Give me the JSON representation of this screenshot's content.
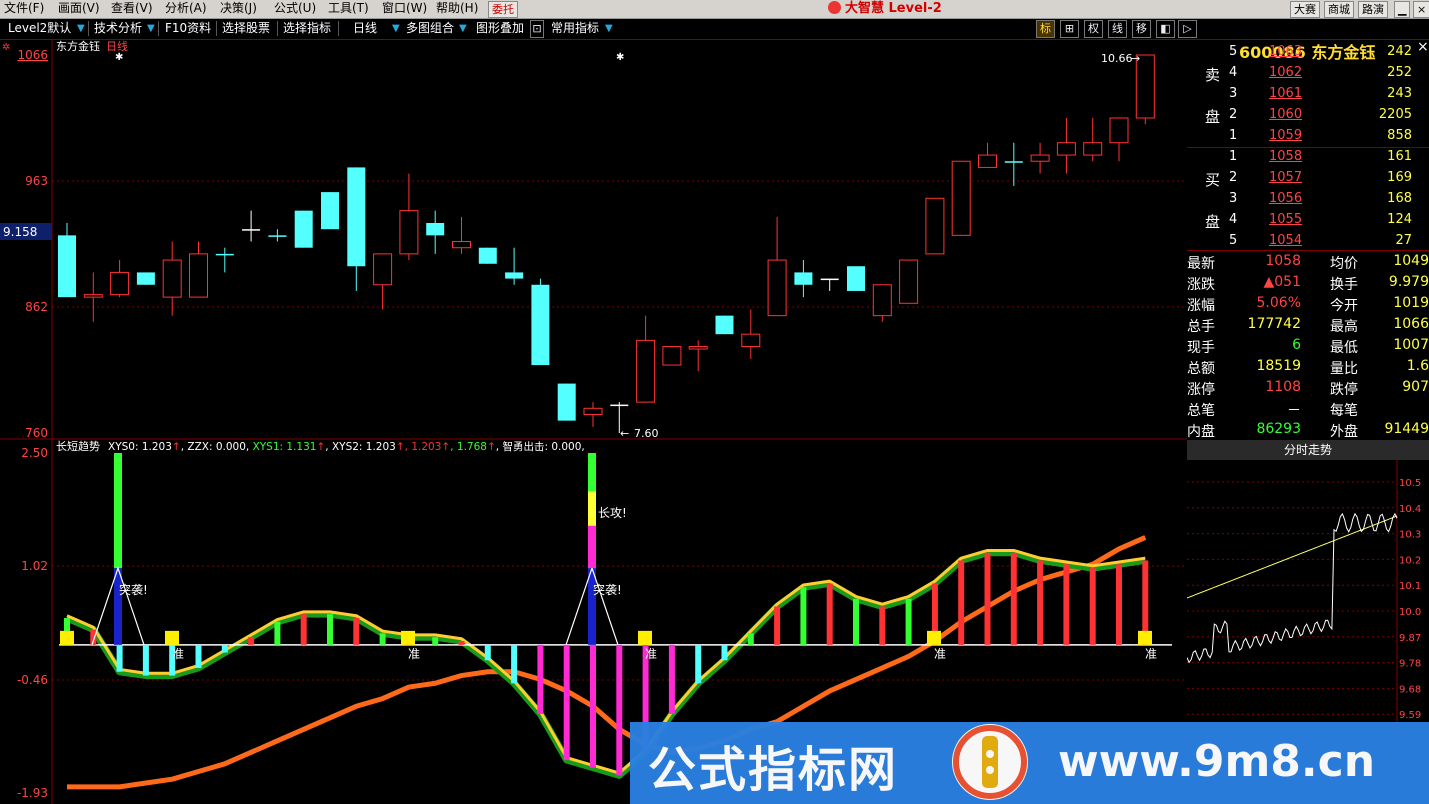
{
  "menubar": {
    "items": [
      "文件(F)",
      "画面(V)",
      "查看(V)",
      "分析(A)",
      "决策(J)",
      "公式(U)",
      "工具(T)",
      "窗口(W)",
      "帮助(H)"
    ],
    "entrust": "委托",
    "title": "大智慧 Level-2",
    "right_buttons": [
      "大赛",
      "商城",
      "路演"
    ]
  },
  "toolbar": {
    "items": [
      "Level2默认",
      "技术分析",
      "F10资料",
      "选择股票",
      "选择指标",
      "日线",
      "多图组合",
      "图形叠加",
      "常用指标"
    ],
    "mode_buttons": [
      "标",
      "⊞",
      "权",
      "线",
      "移",
      "◧",
      "▷"
    ],
    "stock_code": "600086",
    "stock_name": "东方金钰",
    "close": "×"
  },
  "main_chart": {
    "caption_name": "东方金钰",
    "caption_period": "日线",
    "y_ticks": [
      "1066",
      "963",
      "862",
      "760"
    ],
    "cursor_value": "9.158",
    "high_label": "10.66",
    "low_label": "7.60",
    "high_arrow": "→",
    "low_arrow": "←"
  },
  "indicator": {
    "name": "长短趋势",
    "fields": [
      {
        "text": "XYS0: 1.203",
        "color": "#ffffff"
      },
      {
        "text": "↑",
        "color": "#ff3333"
      },
      {
        "text": ", ZZX: 0.000, ",
        "color": "#ffffff"
      },
      {
        "text": "XYS1: 1.131",
        "color": "#33ff33"
      },
      {
        "text": "↑",
        "color": "#ff3333"
      },
      {
        "text": ", XYS2: 1.203",
        "color": "#ffffff"
      },
      {
        "text": "↑",
        "color": "#ff3333"
      },
      {
        "text": ", 1.203",
        "color": "#ff3333"
      },
      {
        "text": "↑",
        "color": "#ff3333"
      },
      {
        "text": ", 1.768",
        "color": "#33ff33"
      },
      {
        "text": "↑",
        "color": "#ff3333"
      },
      {
        "text": ", 智勇出击: 0.000,",
        "color": "#ffffff"
      }
    ],
    "y_ticks": [
      "2.50",
      "1.02",
      "-0.46",
      "-1.93"
    ],
    "labels": {
      "attack": "突袭!",
      "long_attack": "长攻!",
      "ready": "准"
    }
  },
  "chart_data": [
    {
      "type": "candlestick",
      "title": "东方金钰 日线",
      "y_ticks": [
        7.6,
        8.62,
        9.63,
        10.66
      ],
      "ylim": [
        7.6,
        10.66
      ],
      "high": 10.66,
      "low": 7.6,
      "ohlc": [
        [
          9.2,
          8.7,
          9.3,
          8.7
        ],
        [
          8.7,
          8.72,
          8.9,
          8.5
        ],
        [
          8.72,
          8.9,
          9.0,
          8.7
        ],
        [
          8.9,
          8.8,
          8.9,
          8.8
        ],
        [
          8.7,
          9.0,
          9.15,
          8.55
        ],
        [
          8.7,
          9.05,
          9.15,
          8.7
        ],
        [
          9.05,
          9.05,
          9.1,
          8.9
        ],
        [
          9.25,
          9.25,
          9.4,
          9.15
        ],
        [
          9.2,
          9.2,
          9.25,
          9.15
        ],
        [
          9.4,
          9.1,
          9.4,
          9.1
        ],
        [
          9.55,
          9.25,
          9.55,
          9.25
        ],
        [
          9.75,
          8.95,
          9.75,
          8.75
        ],
        [
          8.8,
          9.05,
          9.05,
          8.6
        ],
        [
          9.05,
          9.4,
          9.7,
          9.0
        ],
        [
          9.3,
          9.2,
          9.4,
          9.05
        ],
        [
          9.1,
          9.15,
          9.35,
          9.05
        ],
        [
          9.1,
          8.97,
          9.1,
          8.97
        ],
        [
          8.9,
          8.85,
          9.1,
          8.8
        ],
        [
          8.8,
          8.15,
          8.85,
          8.15
        ],
        [
          8.0,
          7.7,
          8.0,
          7.7
        ],
        [
          7.75,
          7.8,
          7.85,
          7.65
        ],
        [
          7.83,
          7.83,
          7.85,
          7.6
        ],
        [
          7.85,
          8.35,
          8.55,
          7.85
        ],
        [
          8.15,
          8.3,
          8.3,
          8.15
        ],
        [
          8.28,
          8.3,
          8.35,
          8.1
        ],
        [
          8.55,
          8.4,
          8.55,
          8.4
        ],
        [
          8.3,
          8.4,
          8.6,
          8.2
        ],
        [
          8.55,
          9.0,
          9.35,
          8.55
        ],
        [
          8.9,
          8.8,
          9.0,
          8.7
        ],
        [
          8.85,
          8.85,
          8.85,
          8.75
        ],
        [
          8.95,
          8.75,
          8.95,
          8.75
        ],
        [
          8.55,
          8.8,
          8.8,
          8.5
        ],
        [
          8.65,
          9.0,
          9.0,
          8.65
        ],
        [
          9.05,
          9.5,
          9.5,
          9.05
        ],
        [
          9.2,
          9.8,
          9.8,
          9.2
        ],
        [
          9.75,
          9.85,
          9.95,
          9.75
        ],
        [
          9.8,
          9.8,
          9.95,
          9.6
        ],
        [
          9.8,
          9.85,
          9.95,
          9.7
        ],
        [
          9.85,
          9.95,
          10.15,
          9.7
        ],
        [
          9.85,
          9.95,
          10.15,
          9.8
        ],
        [
          9.95,
          10.15,
          10.15,
          9.8
        ],
        [
          10.15,
          10.66,
          10.66,
          10.1
        ]
      ]
    },
    {
      "type": "mixed",
      "title": "长短趋势",
      "ylim": [
        -1.93,
        2.5
      ],
      "y_ticks": [
        2.5,
        1.02,
        -0.46,
        -1.93
      ],
      "series": [
        {
          "name": "XYS0",
          "values": [
            0.35,
            0.2,
            -0.35,
            -0.4,
            -0.4,
            -0.3,
            -0.1,
            0.1,
            0.3,
            0.4,
            0.4,
            0.35,
            0.15,
            0.1,
            0.1,
            0.05,
            -0.2,
            -0.5,
            -0.9,
            -1.5,
            -1.6,
            -1.7,
            -1.4,
            -0.9,
            -0.5,
            -0.2,
            0.15,
            0.5,
            0.75,
            0.8,
            0.6,
            0.5,
            0.6,
            0.8,
            1.1,
            1.2,
            1.2,
            1.1,
            1.05,
            1.0,
            1.05,
            1.1
          ]
        },
        {
          "name": "XYS2",
          "values": [
            -1.85,
            -1.85,
            -1.85,
            -1.8,
            -1.75,
            -1.65,
            -1.55,
            -1.4,
            -1.25,
            -1.1,
            -0.95,
            -0.8,
            -0.7,
            -0.55,
            -0.5,
            -0.4,
            -0.35,
            -0.35,
            -0.45,
            -0.6,
            -0.8,
            -1.1,
            -1.3,
            -1.4,
            -1.35,
            -1.25,
            -1.1,
            -1.0,
            -0.8,
            -0.6,
            -0.45,
            -0.3,
            -0.15,
            0.05,
            0.3,
            0.5,
            0.7,
            0.85,
            0.95,
            1.05,
            1.25,
            1.4
          ]
        }
      ]
    }
  ],
  "orderbook": {
    "sell_label_1": "卖",
    "sell_label_2": "盘",
    "buy_label_1": "买",
    "buy_label_2": "盘",
    "sell": [
      {
        "lv": "5",
        "price": "1063",
        "vol": "242"
      },
      {
        "lv": "4",
        "price": "1062",
        "vol": "252"
      },
      {
        "lv": "3",
        "price": "1061",
        "vol": "243"
      },
      {
        "lv": "2",
        "price": "1060",
        "vol": "2205"
      },
      {
        "lv": "1",
        "price": "1059",
        "vol": "858"
      }
    ],
    "buy": [
      {
        "lv": "1",
        "price": "1058",
        "vol": "161"
      },
      {
        "lv": "2",
        "price": "1057",
        "vol": "169"
      },
      {
        "lv": "3",
        "price": "1056",
        "vol": "168"
      },
      {
        "lv": "4",
        "price": "1055",
        "vol": "124"
      },
      {
        "lv": "5",
        "price": "1054",
        "vol": "27"
      }
    ]
  },
  "quote": [
    {
      "k1": "最新",
      "v1": "1058",
      "c1": "#ff4444",
      "k2": "均价",
      "v2": "1049"
    },
    {
      "k1": "涨跌",
      "v1": "▲051",
      "c1": "#ff4444",
      "k2": "换手",
      "v2": "9.979"
    },
    {
      "k1": "涨幅",
      "v1": "5.06%",
      "c1": "#ff4444",
      "k2": "今开",
      "v2": "1019"
    },
    {
      "k1": "总手",
      "v1": "177742",
      "c1": "#ffff44",
      "k2": "最高",
      "v2": "1066"
    },
    {
      "k1": "现手",
      "v1": "6",
      "c1": "#33ff33",
      "k2": "最低",
      "v2": "1007"
    },
    {
      "k1": "总额",
      "v1": "18519",
      "c1": "#ffff44",
      "k2": "量比",
      "v2": "1.6"
    },
    {
      "k1": "涨停",
      "v1": "1108",
      "c1": "#ff4444",
      "k2": "跌停",
      "v2": "907"
    },
    {
      "k1": "总笔",
      "v1": "－",
      "c1": "#ffffff",
      "k2": "每笔",
      "v2": ""
    },
    {
      "k1": "内盘",
      "v1": "86293",
      "c1": "#33ff33",
      "k2": "外盘",
      "v2": "91449"
    }
  ],
  "minute": {
    "title": "分时走势",
    "y_labels": [
      "10.5",
      "10.4",
      "10.3",
      "10.2",
      "10.1",
      "10.0",
      "9.87",
      "9.78",
      "9.68",
      "9.59"
    ]
  },
  "watermark": {
    "cn": "公式指标网",
    "url": "www.9m8.cn"
  },
  "colors": {
    "up": "#ff3333",
    "down": "#54ffff",
    "grid": "#800000",
    "accent": "#ffdd33"
  }
}
